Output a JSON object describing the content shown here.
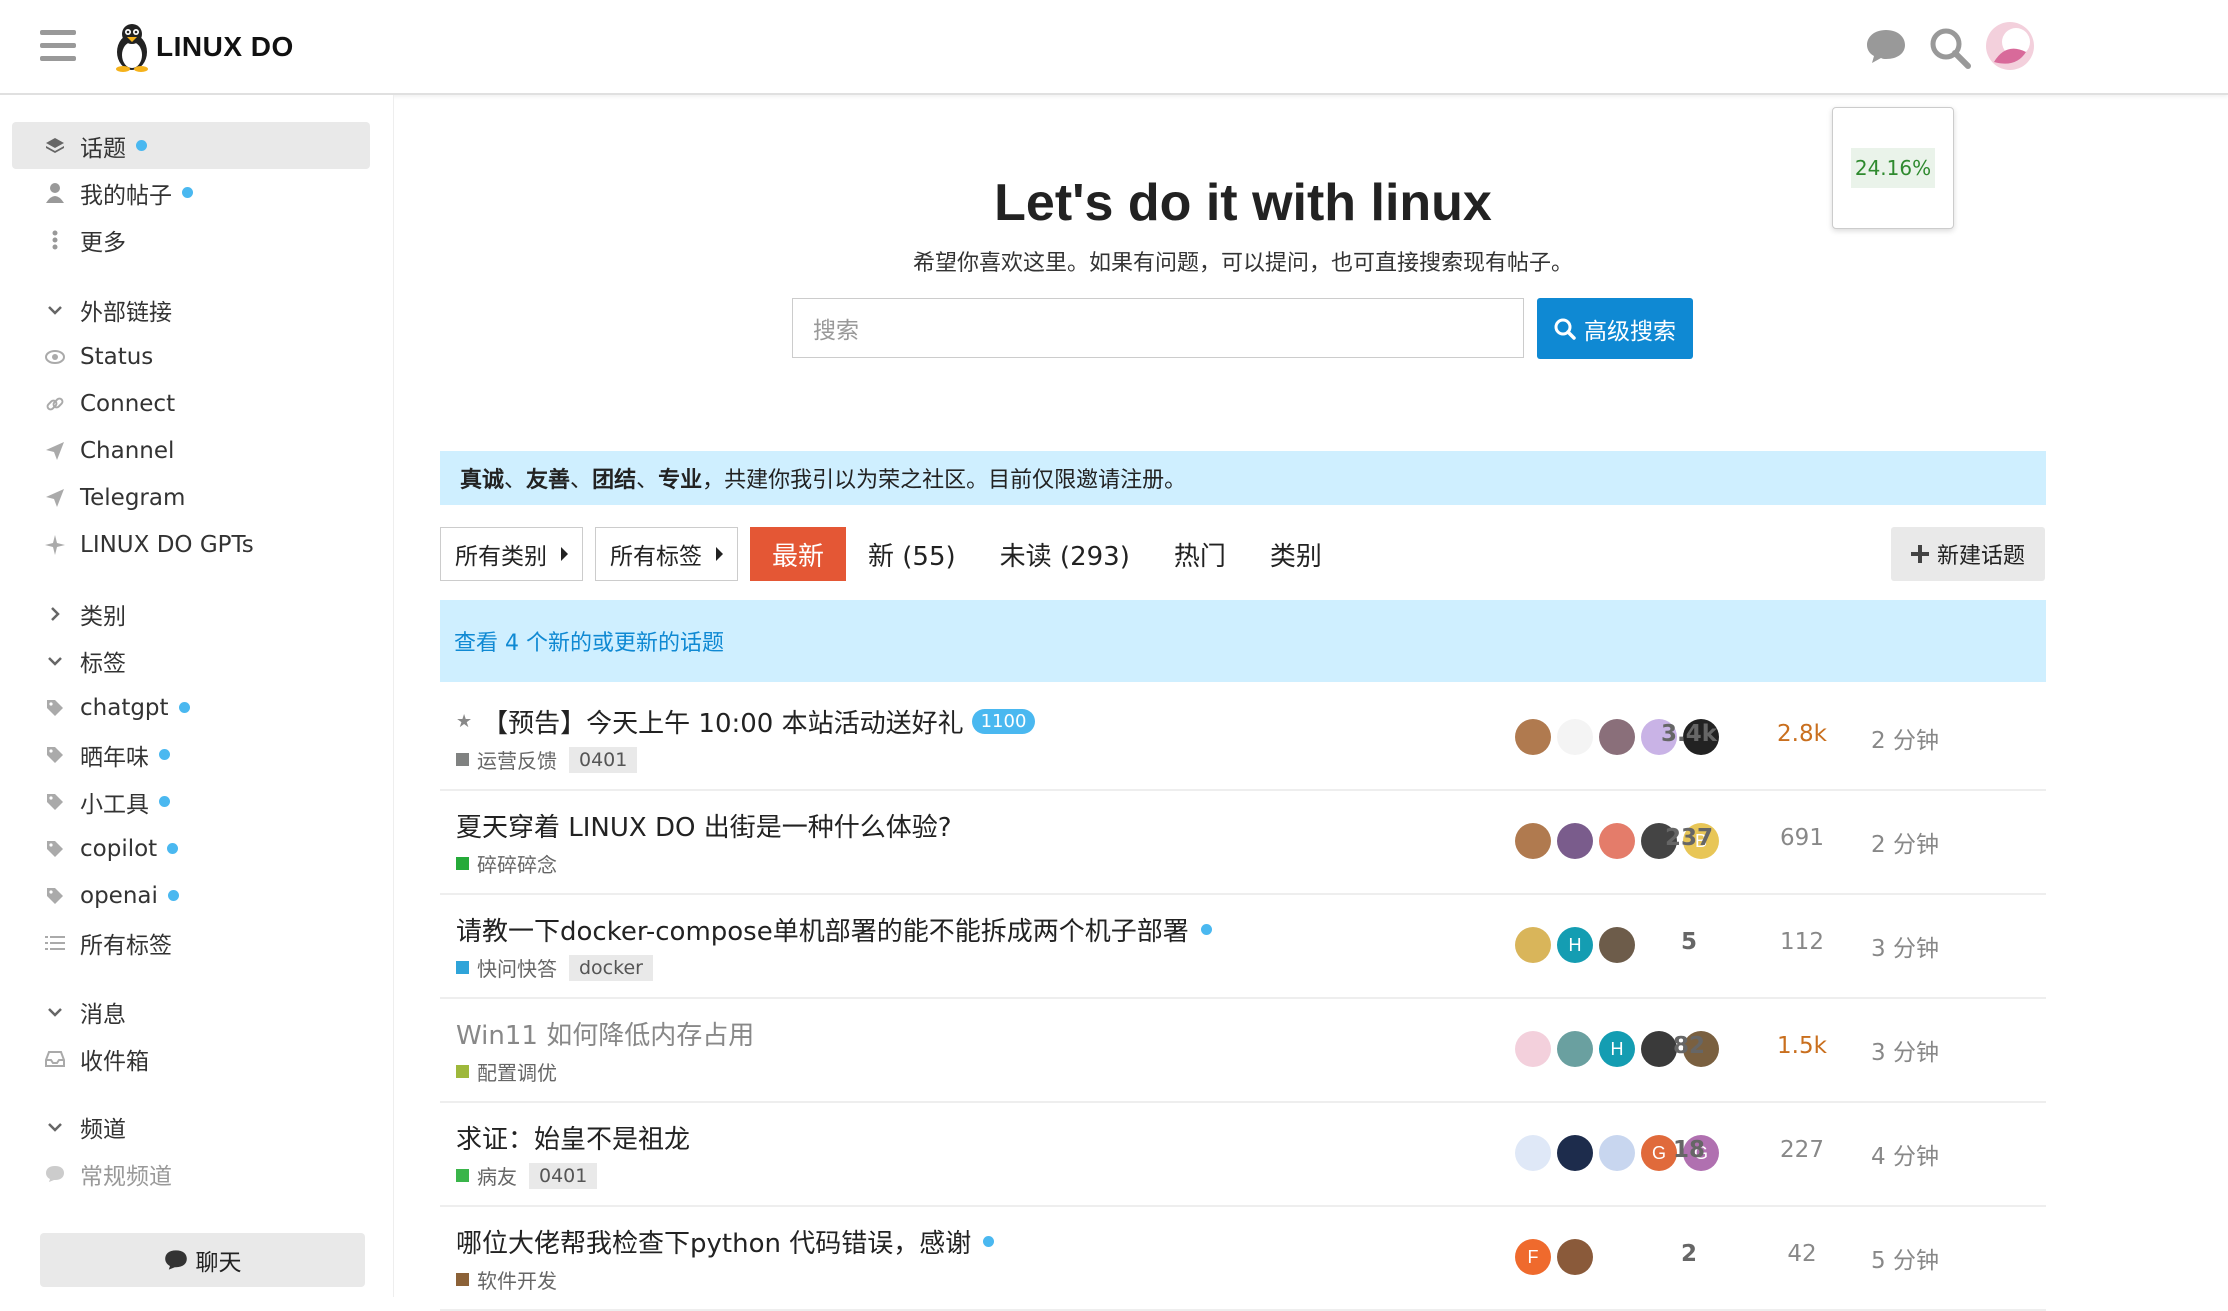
{
  "header": {
    "logo_text": "LINUX DO",
    "icons": [
      "hamburger-icon",
      "chat-bubble-icon",
      "search-icon",
      "avatar"
    ]
  },
  "sidebar": {
    "items": [
      {
        "label": "话题",
        "icon": "layers-icon",
        "dot": true,
        "active": true
      },
      {
        "label": "我的帖子",
        "icon": "user-icon",
        "dot": true
      },
      {
        "label": "更多",
        "icon": "more-vertical-icon"
      }
    ],
    "external": {
      "title": "外部链接",
      "items": [
        {
          "label": "Status",
          "icon": "eye-icon"
        },
        {
          "label": "Connect",
          "icon": "link-icon"
        },
        {
          "label": "Channel",
          "icon": "send-icon"
        },
        {
          "label": "Telegram",
          "icon": "send-icon"
        },
        {
          "label": "LINUX DO GPTs",
          "icon": "sparkle-icon"
        }
      ]
    },
    "categories_title": "类别",
    "tags": {
      "title": "标签",
      "items": [
        {
          "label": "chatgpt",
          "dot": true
        },
        {
          "label": "晒年味",
          "dot": true
        },
        {
          "label": "小工具",
          "dot": true
        },
        {
          "label": "copilot",
          "dot": true
        },
        {
          "label": "openai",
          "dot": true
        },
        {
          "label": "所有标签",
          "icon": "list-icon"
        }
      ]
    },
    "messages": {
      "title": "消息",
      "items": [
        {
          "label": "收件箱",
          "icon": "inbox-icon"
        }
      ]
    },
    "channels": {
      "title": "频道",
      "items": [
        {
          "label": "常规频道",
          "icon": "chat-icon"
        }
      ]
    },
    "chat_button": "聊天"
  },
  "banner": {
    "title": "Let's do it with linux",
    "subtitle": "希望你喜欢这里。如果有问题，可以提问，也可直接搜索现有帖子。",
    "search_placeholder": "搜索",
    "advanced_search": "高级搜索"
  },
  "percent": "24.16%",
  "notice": {
    "bold_words": [
      "真诚",
      "友善",
      "团结",
      "专业"
    ],
    "sep": "、",
    "rest": "，共建你我引以为荣之社区。目前仅限邀请注册。"
  },
  "nav": {
    "categories_dd": "所有类别",
    "tags_dd": "所有标签",
    "tabs": [
      {
        "label": "最新",
        "active": true
      },
      {
        "label": "新 (55)"
      },
      {
        "label": "未读 (293)"
      },
      {
        "label": "热门"
      },
      {
        "label": "类别"
      }
    ],
    "new_topic": "新建话题"
  },
  "new_topics_bar": "查看 4 个新的或更新的话题",
  "topics": [
    {
      "title": "【预告】今天上午 10:00 本站活动送好礼",
      "pinned": true,
      "badge": "1100",
      "category": "运营反馈",
      "cat_color": "#808281",
      "tag": "0401",
      "replies": "3.4k",
      "views": "2.8k",
      "views_hot": true,
      "activity": "2 分钟",
      "avatars": [
        {
          "bg": "#b07a4f"
        },
        {
          "bg": "#f4f4f4",
          "fg": "#333"
        },
        {
          "bg": "#8a6f7a"
        },
        {
          "bg": "#c9b3e6"
        },
        {
          "bg": "#222"
        }
      ]
    },
    {
      "title": "夏天穿着 LINUX DO 出街是一种什么体验?",
      "category": "碎碎碎念",
      "cat_color": "#25aa39",
      "replies": "237",
      "views": "691",
      "activity": "2 分钟",
      "avatars": [
        {
          "bg": "#b07a4f"
        },
        {
          "bg": "#7a5c8c"
        },
        {
          "bg": "#e47c6a"
        },
        {
          "bg": "#444"
        },
        {
          "bg": "#e8c657",
          "letter": "B"
        }
      ]
    },
    {
      "title": "请教一下docker-compose单机部署的能不能拆成两个机子部署",
      "new_dot": true,
      "category": "快问快答",
      "cat_color": "#2fa4d9",
      "tag": "docker",
      "replies": "5",
      "views": "112",
      "activity": "3 分钟",
      "avatars": [
        {
          "bg": "#d9b55a"
        },
        {
          "bg": "#149db2",
          "letter": "H"
        },
        {
          "bg": "#6d5c4a"
        }
      ]
    },
    {
      "title": "Win11 如何降低内存占用",
      "read": true,
      "category": "配置调优",
      "cat_color": "#9eb83b",
      "replies": "82",
      "views": "1.5k",
      "views_hot": true,
      "activity": "3 分钟",
      "avatars": [
        {
          "bg": "#f3d0dc"
        },
        {
          "bg": "#6aa0a0"
        },
        {
          "bg": "#149db2",
          "letter": "H"
        },
        {
          "bg": "#3a3a3a"
        },
        {
          "bg": "#7a6040"
        }
      ]
    },
    {
      "title": "求证：始皇不是祖龙",
      "category": "病友",
      "cat_color": "#3ab54a",
      "tag": "0401",
      "replies": "18",
      "views": "227",
      "activity": "4 分钟",
      "avatars": [
        {
          "bg": "#dfe8f7"
        },
        {
          "bg": "#1d2c4c"
        },
        {
          "bg": "#c8d6ef"
        },
        {
          "bg": "#e06a3b",
          "letter": "G"
        },
        {
          "bg": "#b070b0",
          "letter": "G"
        }
      ]
    },
    {
      "title": "哪位大佬帮我检查下python 代码错误，感谢",
      "new_dot": true,
      "category": "软件开发",
      "cat_color": "#8c6238",
      "replies": "2",
      "views": "42",
      "activity": "5 分钟",
      "avatars": [
        {
          "bg": "#ef6a2d",
          "letter": "F"
        },
        {
          "bg": "#8a5a3a"
        }
      ]
    }
  ]
}
